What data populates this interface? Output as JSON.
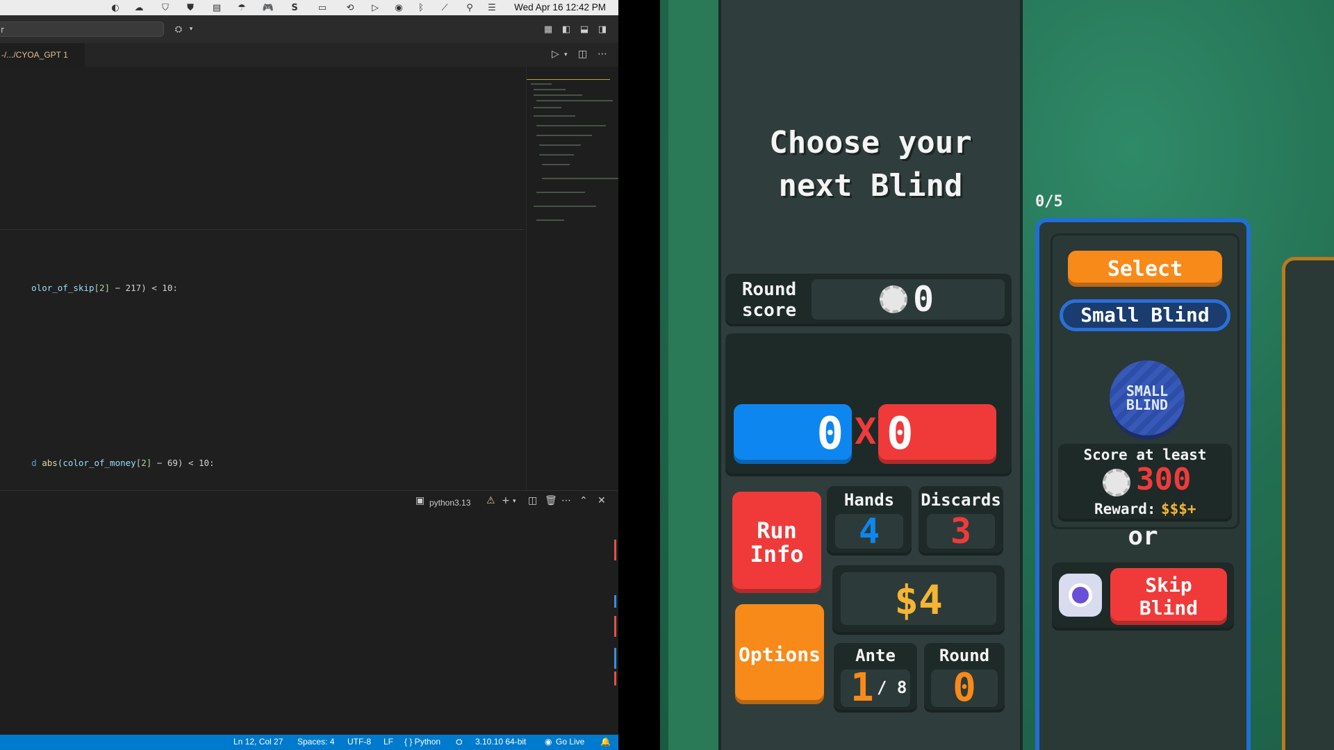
{
  "menubar": {
    "clock": "Wed Apr 16  12:42 PM"
  },
  "vscode": {
    "search_placeholder": "r",
    "active_tab": "-/.../CYOA_GPT 1",
    "code": {
      "line1_prefix": "olor_of_skip",
      "line1_index": "[2]",
      "line1_rest": " − 217) < 10:",
      "line2_prefix": "d ",
      "line2_fn": "abs",
      "line2_var": "(color_of_money",
      "line2_index": "[2]",
      "line2_rest": " − 69) < 10:"
    },
    "terminal_label": "python3.13",
    "status": {
      "position": "Ln 12, Col 27",
      "spaces": "Spaces: 4",
      "encoding": "UTF-8",
      "eol": "LF",
      "language": "{ } Python",
      "interpreter": "3.10.10 64-bit",
      "golive": "Go Live"
    }
  },
  "game": {
    "title_line1": "Choose your",
    "title_line2": "next Blind",
    "round_score_label_1": "Round",
    "round_score_label_2": "score",
    "round_score_value": "0",
    "chips_value": "0",
    "mult_sign": "X",
    "mult_value": "0",
    "run_info_1": "Run",
    "run_info_2": "Info",
    "options_label": "Options",
    "hands_label": "Hands",
    "hands_value": "4",
    "discards_label": "Discards",
    "discards_value": "3",
    "money": "$4",
    "ante_label": "Ante",
    "ante_value": "1",
    "ante_max": "/ 8",
    "round_label": "Round",
    "round_value": "0",
    "blind_counter": "0/5",
    "select_label": "Select",
    "small_blind_label": "Small Blind",
    "token_line1": "SMALL",
    "token_line2": "BLIND",
    "score_at_least": "Score at least",
    "target_score": "300",
    "reward_label": "Reward:",
    "reward_value": "$$$+",
    "or_label": "or",
    "skip_label": "Skip Blind"
  },
  "colors": {
    "chips_blue": "#0e86f0",
    "mult_red": "#f03a3a",
    "money_gold": "#f5b433",
    "select_orange": "#f88a1a",
    "blind_blue": "#1f6fd6"
  }
}
